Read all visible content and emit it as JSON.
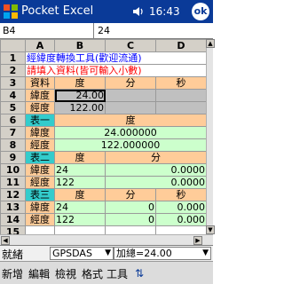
{
  "titlebar": {
    "title": "Pocket Excel",
    "time": "16:43",
    "ok_label": "ok"
  },
  "formula_bar": {
    "cell_ref": "B4",
    "value": "24"
  },
  "columns": [
    "A",
    "B",
    "C",
    "D"
  ],
  "rows": [
    {
      "n": "1",
      "a": "經緯度轉換工具(歡迎流通)"
    },
    {
      "n": "2",
      "a": "請填入資料(皆可輸入小數)"
    },
    {
      "n": "3",
      "a": "資料",
      "b": "度",
      "c": "分",
      "d": "秒"
    },
    {
      "n": "4",
      "a": "緯度",
      "b": "24.00",
      "c": "",
      "d": ""
    },
    {
      "n": "5",
      "a": "經度",
      "b": "122.00",
      "c": "",
      "d": ""
    },
    {
      "n": "6",
      "a": "表一",
      "b": "度"
    },
    {
      "n": "7",
      "a": "緯度",
      "b": "24.000000"
    },
    {
      "n": "8",
      "a": "經度",
      "b": "122.000000"
    },
    {
      "n": "9",
      "a": "表二",
      "b": "度",
      "c": "分"
    },
    {
      "n": "10",
      "a": "緯度",
      "b": "24",
      "c": "0.0000"
    },
    {
      "n": "11",
      "a": "經度",
      "b": "122",
      "c": "0.0000"
    },
    {
      "n": "12",
      "a": "表三",
      "b": "度",
      "c": "分",
      "d": "秒"
    },
    {
      "n": "13",
      "a": "緯度",
      "b": "24",
      "c": "0",
      "d": "0.000"
    },
    {
      "n": "14",
      "a": "經度",
      "b": "122",
      "c": "0",
      "d": "0.000"
    },
    {
      "n": "15",
      "a": "",
      "b": "",
      "c": "",
      "d": ""
    }
  ],
  "status": {
    "ready": "就緒",
    "sheet": "GPSDAS",
    "sum": "加總=24.00"
  },
  "menu": {
    "new": "新增",
    "edit": "編輯",
    "view": "檢視",
    "format": "格式",
    "tools": "工具"
  },
  "colors": {
    "title_bar": "#0a3a98",
    "header_orange": "#ffcc99",
    "section_cyan": "#33cccc",
    "value_green": "#ccffcc"
  }
}
